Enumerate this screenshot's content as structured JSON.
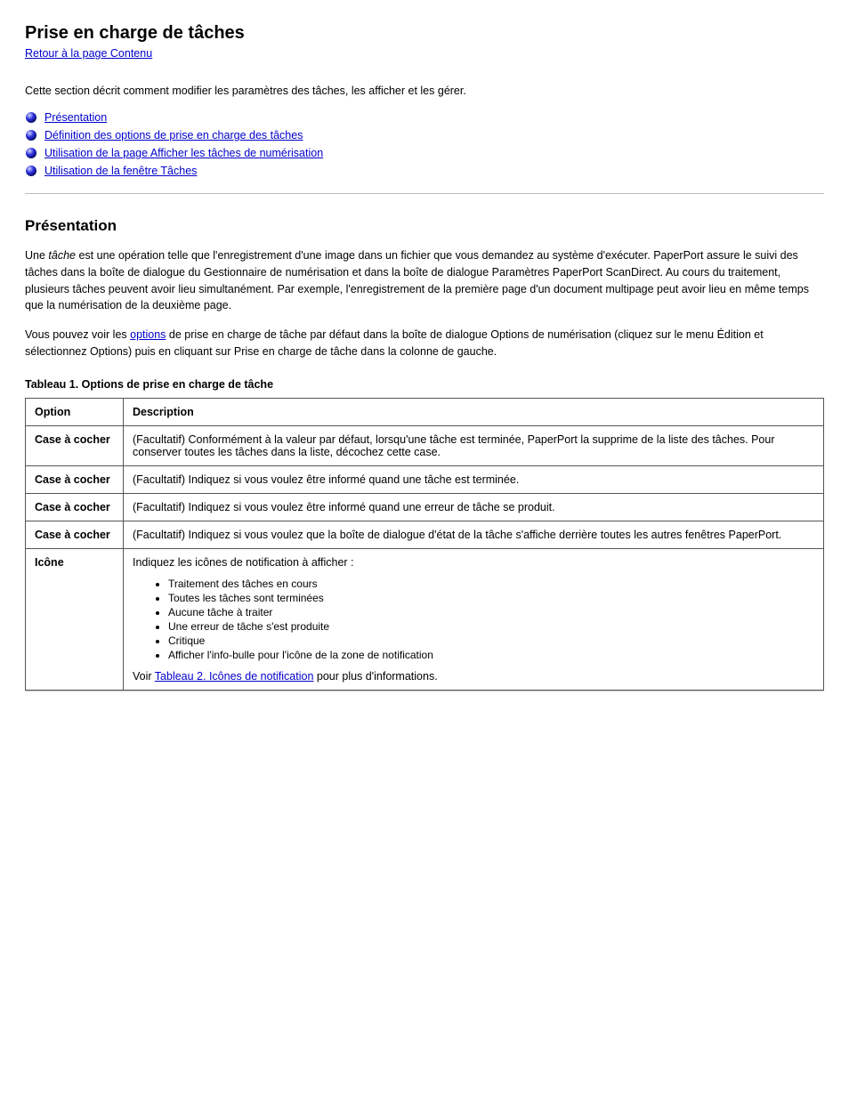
{
  "page_title": "Prise en charge de tâches",
  "back_link": "Retour à la page Contenu",
  "intro_text": "Cette section décrit comment modifier les paramètres des tâches, les afficher et les gérer.",
  "nav": [
    {
      "label": "Présentation"
    },
    {
      "label": "Définition des options de prise en charge des tâches"
    },
    {
      "label": "Utilisation de la page Afficher les tâches de numérisation"
    },
    {
      "label": "Utilisation de la fenêtre Tâches"
    }
  ],
  "overview": {
    "heading": "Présentation",
    "p1_a": "Une ",
    "p1_em": "tâche",
    "p1_b": " est une opération telle que l'enregistrement d'une image dans un fichier que vous demandez au système d'exécuter. PaperPort assure le suivi des tâches dans la boîte de dialogue du Gestionnaire de numérisation et dans la boîte de dialogue Paramètres PaperPort ScanDirect. Au cours du traitement, plusieurs tâches peuvent avoir lieu simultanément. Par exemple, l'enregistrement de la première page d'un document multipage peut avoir lieu en même temps que la numérisation de la deuxième page.",
    "p2_a": "Vous pouvez voir les ",
    "p2_link": "options",
    "p2_b": " de prise en charge de tâche par défaut dans la boîte de dialogue Options de numérisation (cliquez sur le menu Édition et sélectionnez Options) puis en cliquant sur Prise en charge de tâche dans la colonne de gauche."
  },
  "table": {
    "caption": "Tableau 1. Options de prise en charge de tâche",
    "head_option": "Option",
    "head_desc": "Description",
    "rows": [
      {
        "option": "Case à cocher",
        "desc_simple": "(Facultatif) Conformément à la valeur par défaut, lorsqu'une tâche est terminée, PaperPort la supprime de la liste des tâches. Pour conserver toutes les tâches dans la liste, décochez cette case."
      },
      {
        "option": "Case à cocher",
        "desc_simple": "(Facultatif) Indiquez si vous voulez être informé quand une tâche est terminée."
      },
      {
        "option": "Case à cocher",
        "desc_simple": "(Facultatif) Indiquez si vous voulez être informé quand une erreur de tâche se produit."
      },
      {
        "option": "Case à cocher",
        "desc_simple": "(Facultatif) Indiquez si vous voulez que la boîte de dialogue d'état de la tâche s'affiche derrière toutes les autres fenêtres PaperPort."
      },
      {
        "option": "Icône",
        "desc_p": "Indiquez les icônes de notification à afficher :",
        "items": [
          "Traitement des tâches en cours",
          "Toutes les tâches sont terminées",
          "Aucune tâche à traiter",
          "Une erreur de tâche s'est produite",
          "Critique",
          "Afficher l'info-bulle pour l'icône de la zone de notification"
        ],
        "more_prefix": "Voir ",
        "more_link": "Tableau 2. Icônes de notification",
        "more_suffix": " pour plus d'informations."
      }
    ]
  }
}
